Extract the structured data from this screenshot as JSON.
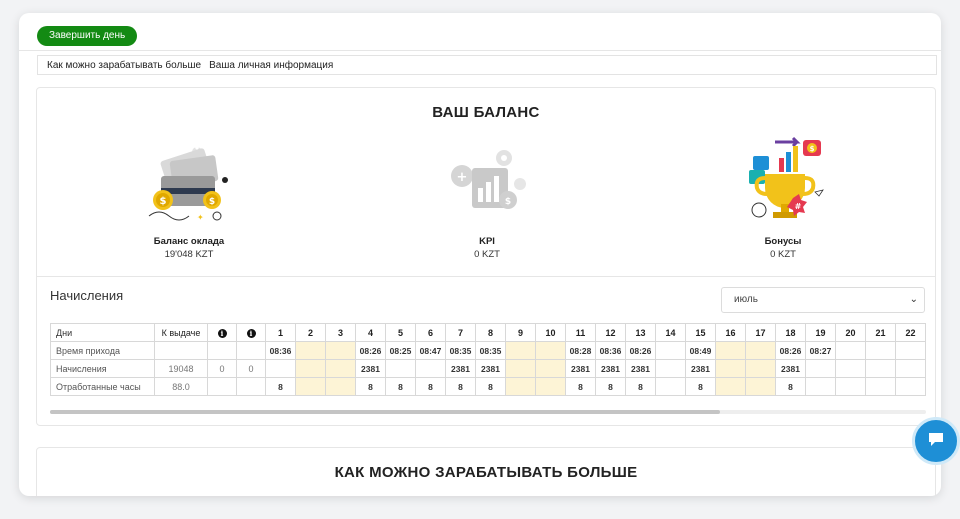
{
  "toolbar": {
    "finish_day_label": "Завершить день"
  },
  "nav": {
    "items": [
      "Как можно зарабатывать больше",
      "Ваша личная информация"
    ]
  },
  "balance": {
    "title": "ВАШ БАЛАНС",
    "items": [
      {
        "name": "Баланс оклада",
        "value": "19'048 KZT",
        "icon": "wallet-coins-icon"
      },
      {
        "name": "KPI",
        "value": "0 KZT",
        "icon": "kpi-chart-icon"
      },
      {
        "name": "Бонусы",
        "value": "0 KZT",
        "icon": "bonus-trophy-icon"
      }
    ]
  },
  "accruals": {
    "title": "Начисления",
    "month": "июль",
    "headers": {
      "days": "Дни",
      "payout": "К выдаче",
      "info1": "i",
      "info2": "i"
    },
    "days": [
      "1",
      "2",
      "3",
      "4",
      "5",
      "6",
      "7",
      "8",
      "9",
      "10",
      "11",
      "12",
      "13",
      "14",
      "15",
      "16",
      "17",
      "18",
      "19",
      "20",
      "21",
      "22"
    ],
    "weekend_days": [
      "2",
      "3",
      "9",
      "10",
      "16",
      "17"
    ],
    "rows": [
      {
        "label": "Время прихода",
        "payout": "",
        "i1": "",
        "i2": "",
        "cells": [
          "08:36",
          "",
          "",
          "08:26",
          "08:25",
          "08:47",
          "08:35",
          "08:35",
          "",
          "",
          "08:28",
          "08:36",
          "08:26",
          "",
          "08:49",
          "",
          "",
          "08:26",
          "08:27",
          "",
          "",
          ""
        ]
      },
      {
        "label": "Начисления",
        "payout": "19048",
        "i1": "0",
        "i2": "0",
        "cells": [
          "",
          "",
          "",
          "2381",
          "",
          "",
          "2381",
          "2381",
          "",
          "",
          "2381",
          "2381",
          "2381",
          "",
          "2381",
          "",
          "",
          "2381",
          "",
          "",
          "",
          ""
        ]
      },
      {
        "label": "Отработанные часы",
        "payout": "88.0",
        "i1": "",
        "i2": "",
        "cells": [
          "8",
          "",
          "",
          "8",
          "8",
          "8",
          "8",
          "8",
          "",
          "",
          "8",
          "8",
          "8",
          "",
          "8",
          "",
          "",
          "8",
          "",
          "",
          "",
          ""
        ]
      }
    ]
  },
  "earn": {
    "title": "КАК МОЖНО ЗАРАБАТЫВАТЬ БОЛЬШЕ"
  },
  "chat": {
    "icon": "chat-bubble-icon"
  },
  "colors": {
    "accent_green": "#138a13",
    "weekend": "#fdf4d6",
    "chat_blue": "#1e8fd6"
  }
}
